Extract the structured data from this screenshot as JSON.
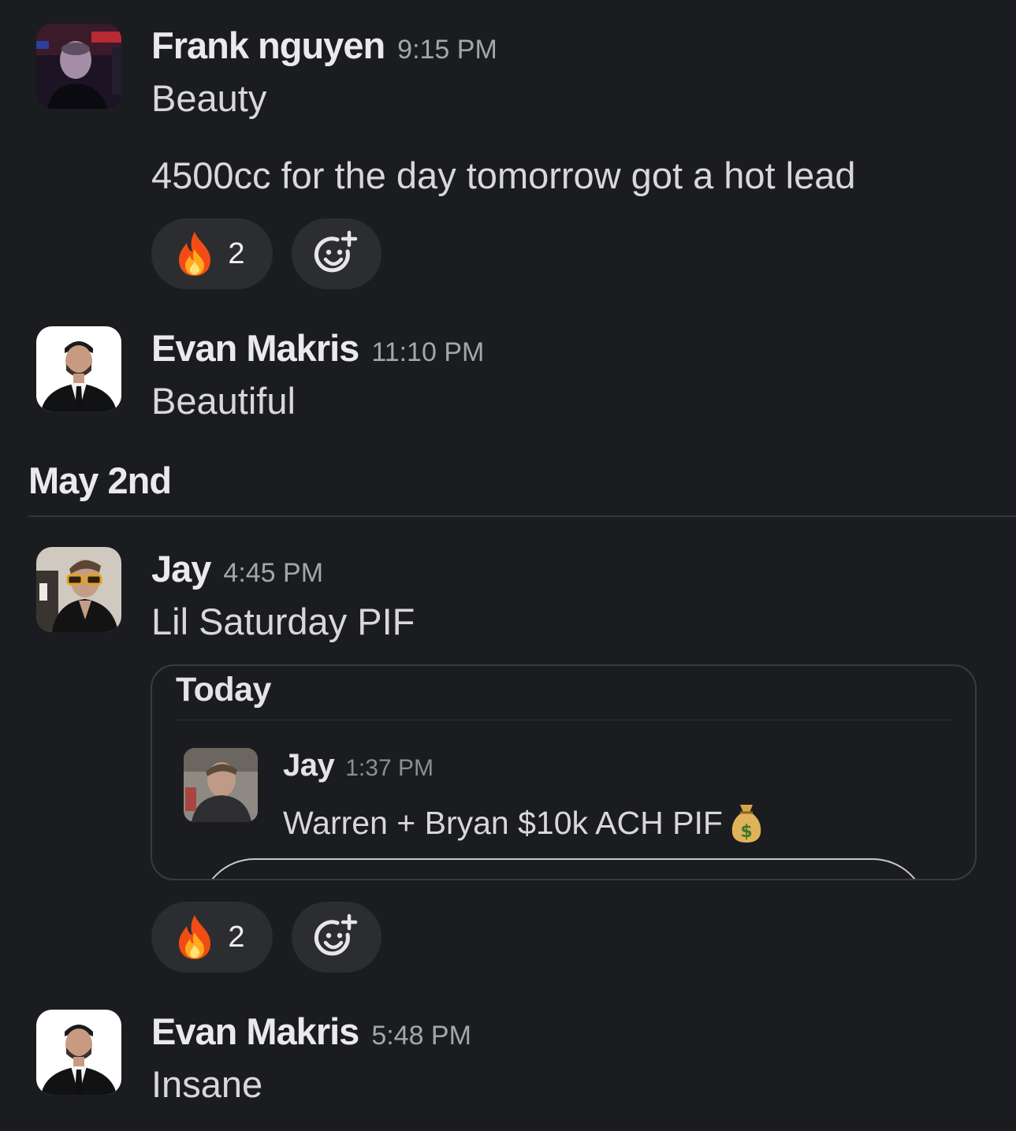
{
  "messages": [
    {
      "author": "Frank nguyen",
      "time": "9:15 PM",
      "lines": [
        "Beauty",
        "4500cc for the day tomorrow got a hot lead"
      ],
      "reactions": [
        {
          "emoji": "fire-emoji",
          "count": "2"
        }
      ],
      "avatar": "avatar-frank"
    },
    {
      "author": "Evan Makris",
      "time": "11:10 PM",
      "lines": [
        "Beautiful"
      ],
      "avatar": "avatar-evan"
    },
    {
      "author": "Jay",
      "time": "4:45 PM",
      "lines": [
        "Lil Saturday PIF"
      ],
      "reactions": [
        {
          "emoji": "fire-emoji",
          "count": "2"
        }
      ],
      "avatar": "avatar-jay",
      "embed": {
        "title": "Today",
        "author": "Jay",
        "time": "1:37 PM",
        "text": "Warren + Bryan $10k ACH PIF",
        "trailing_emoji": "money-bag-emoji"
      }
    },
    {
      "author": "Evan Makris",
      "time": "5:48 PM",
      "lines": [
        "Insane"
      ],
      "avatar": "avatar-evan"
    }
  ],
  "date_divider": {
    "label": "May 2nd"
  },
  "icons": {
    "add_reaction": "add-reaction-icon",
    "fire": "fire-emoji"
  },
  "colors": {
    "background": "#1b1c20",
    "pill": "#2c2d31",
    "muted_text": "#a5a6aa"
  }
}
